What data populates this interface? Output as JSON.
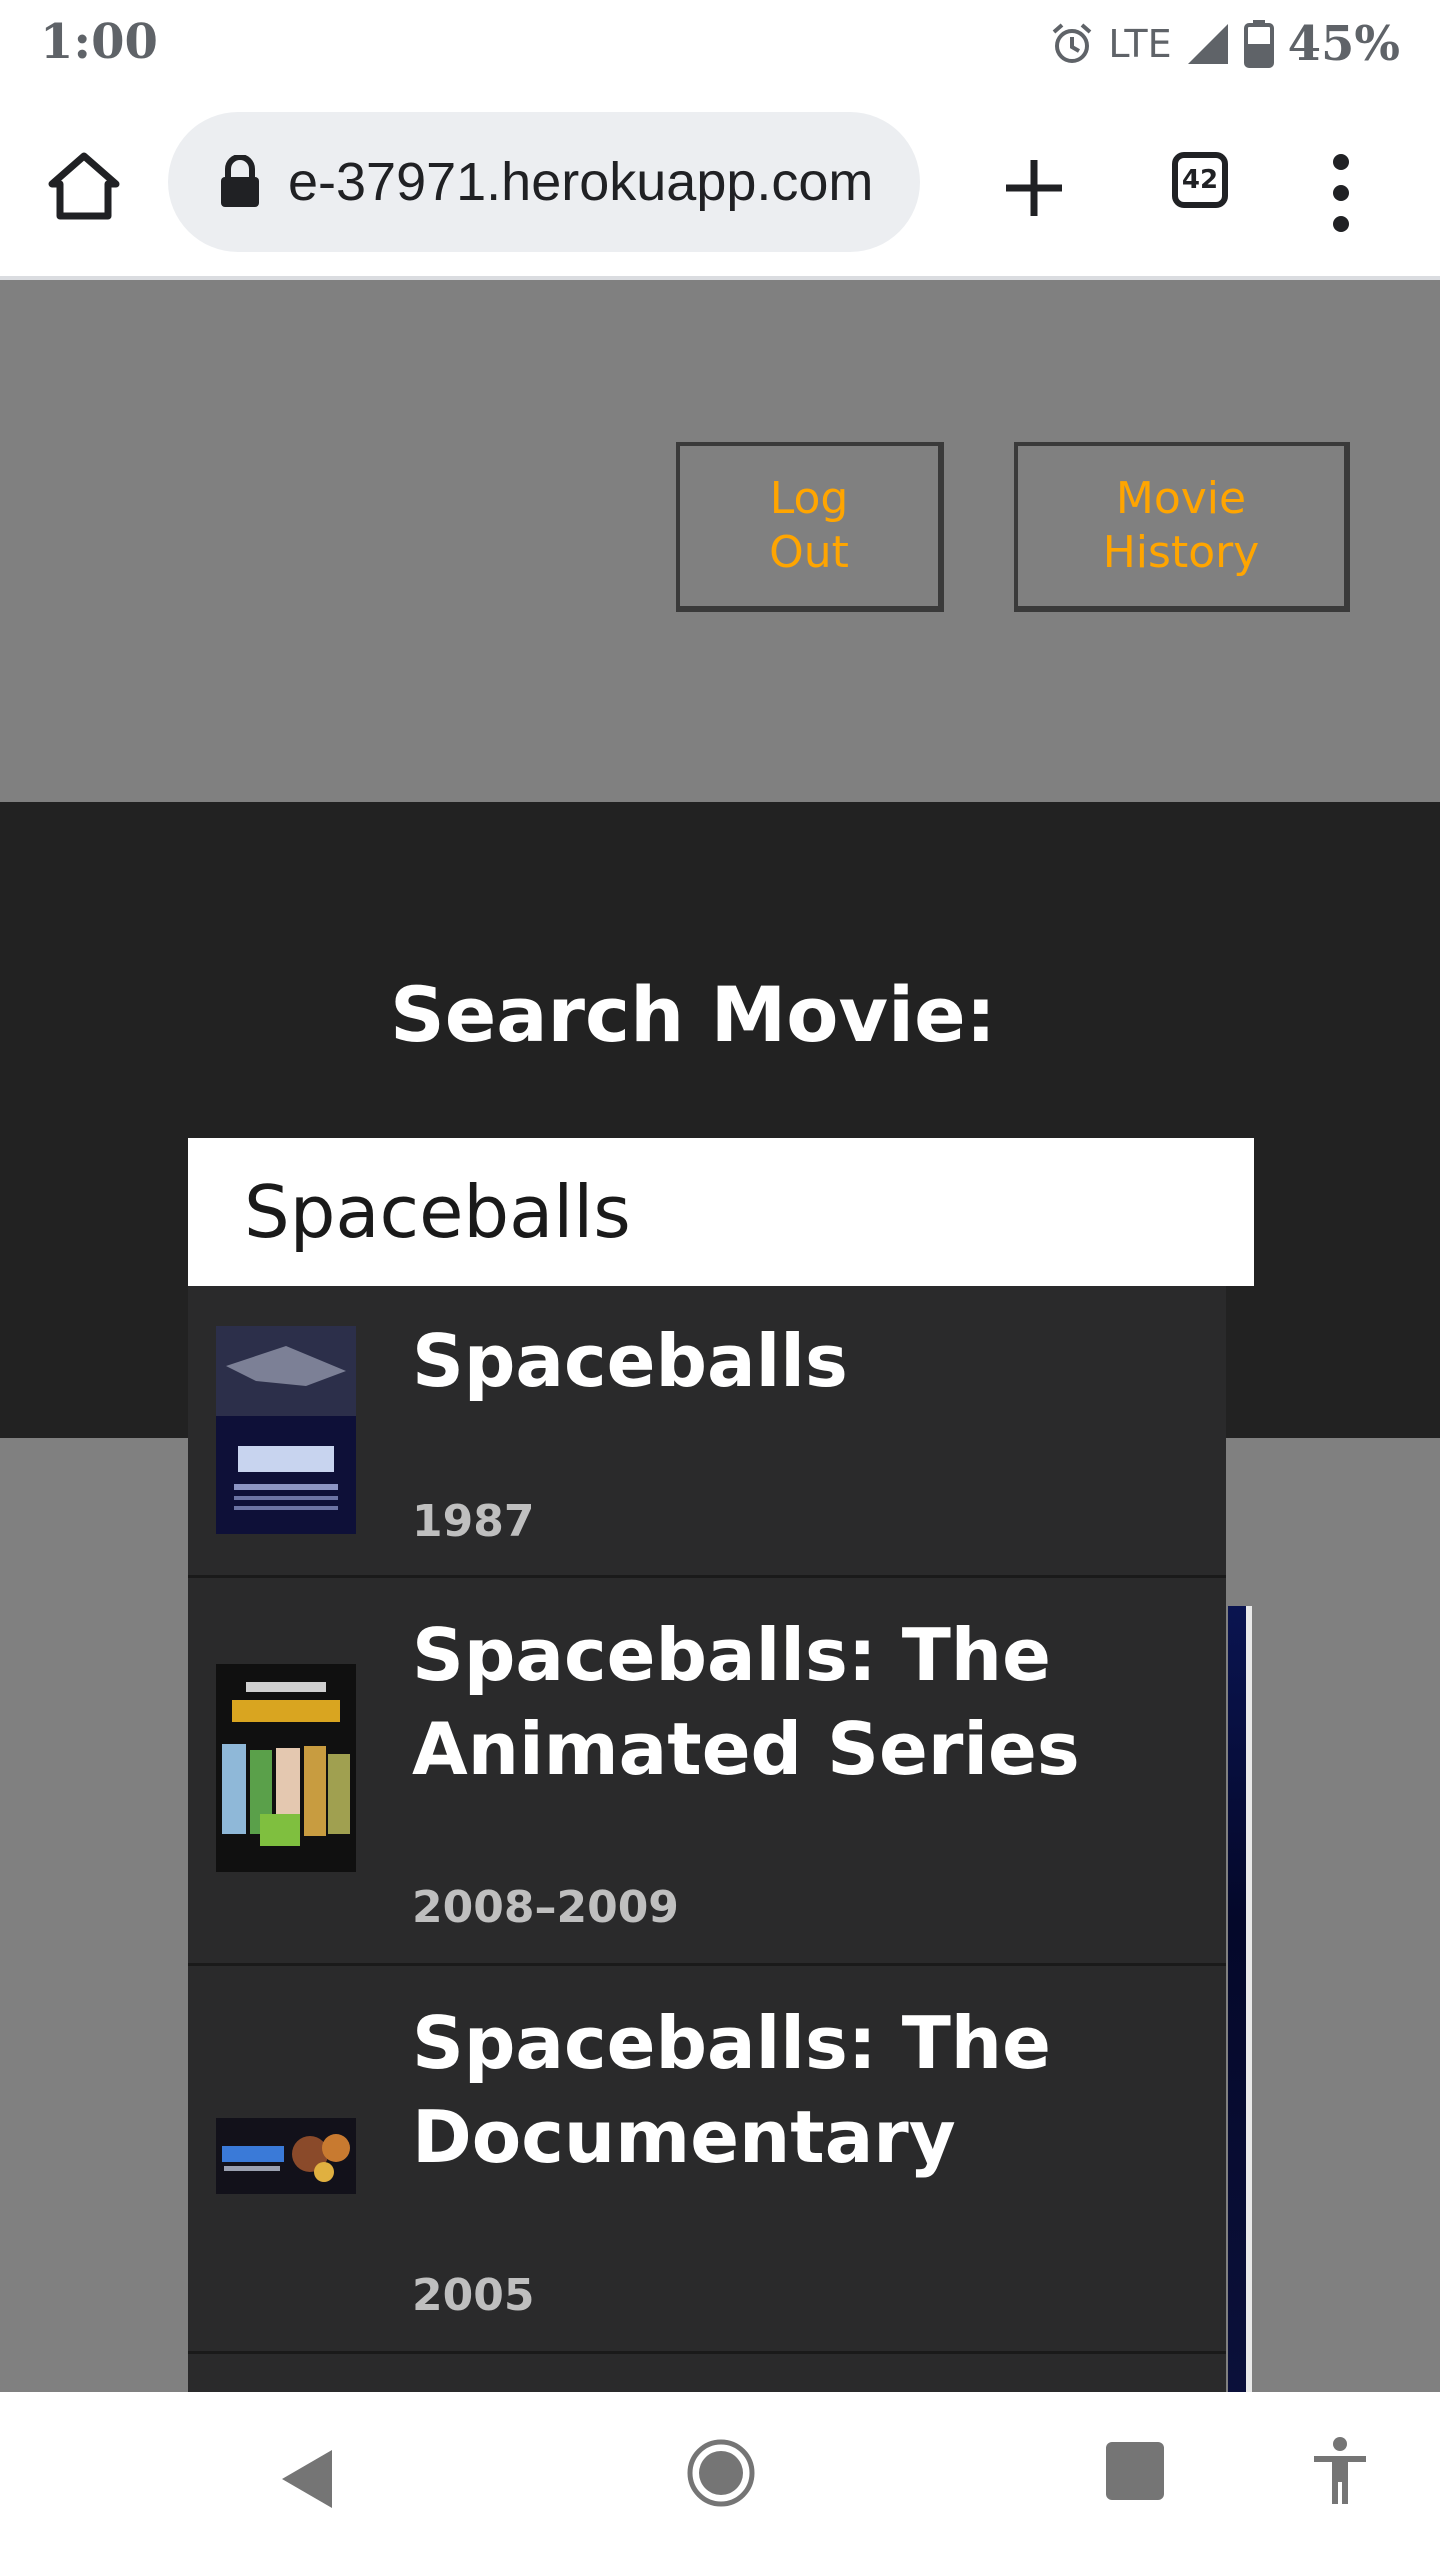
{
  "status_bar": {
    "time": "1:00",
    "network": "LTE",
    "battery": "45%",
    "icons": [
      "alarm-icon",
      "signal-icon",
      "battery-icon"
    ]
  },
  "browser": {
    "url": "e-37971.herokuapp.com",
    "tab_count": "42",
    "icons": [
      "home-icon",
      "lock-icon",
      "new-tab-icon",
      "tab-switcher-icon",
      "overflow-menu-icon"
    ]
  },
  "header": {
    "logout_label": "Log\nOut",
    "history_label": "Movie\nHistory",
    "button_text_color": "#ffa500"
  },
  "search": {
    "title": "Search Movie:",
    "value": "Spaceballs"
  },
  "results": [
    {
      "title": "Spaceballs",
      "year": "1987"
    },
    {
      "title": "Spaceballs: The Animated Series",
      "year": "2008–2009"
    },
    {
      "title": "Spaceballs: The Documentary",
      "year": "2005"
    }
  ],
  "nav_bar": {
    "icons": [
      "back-icon",
      "home-circle-icon",
      "recents-icon",
      "accessibility-icon"
    ]
  }
}
